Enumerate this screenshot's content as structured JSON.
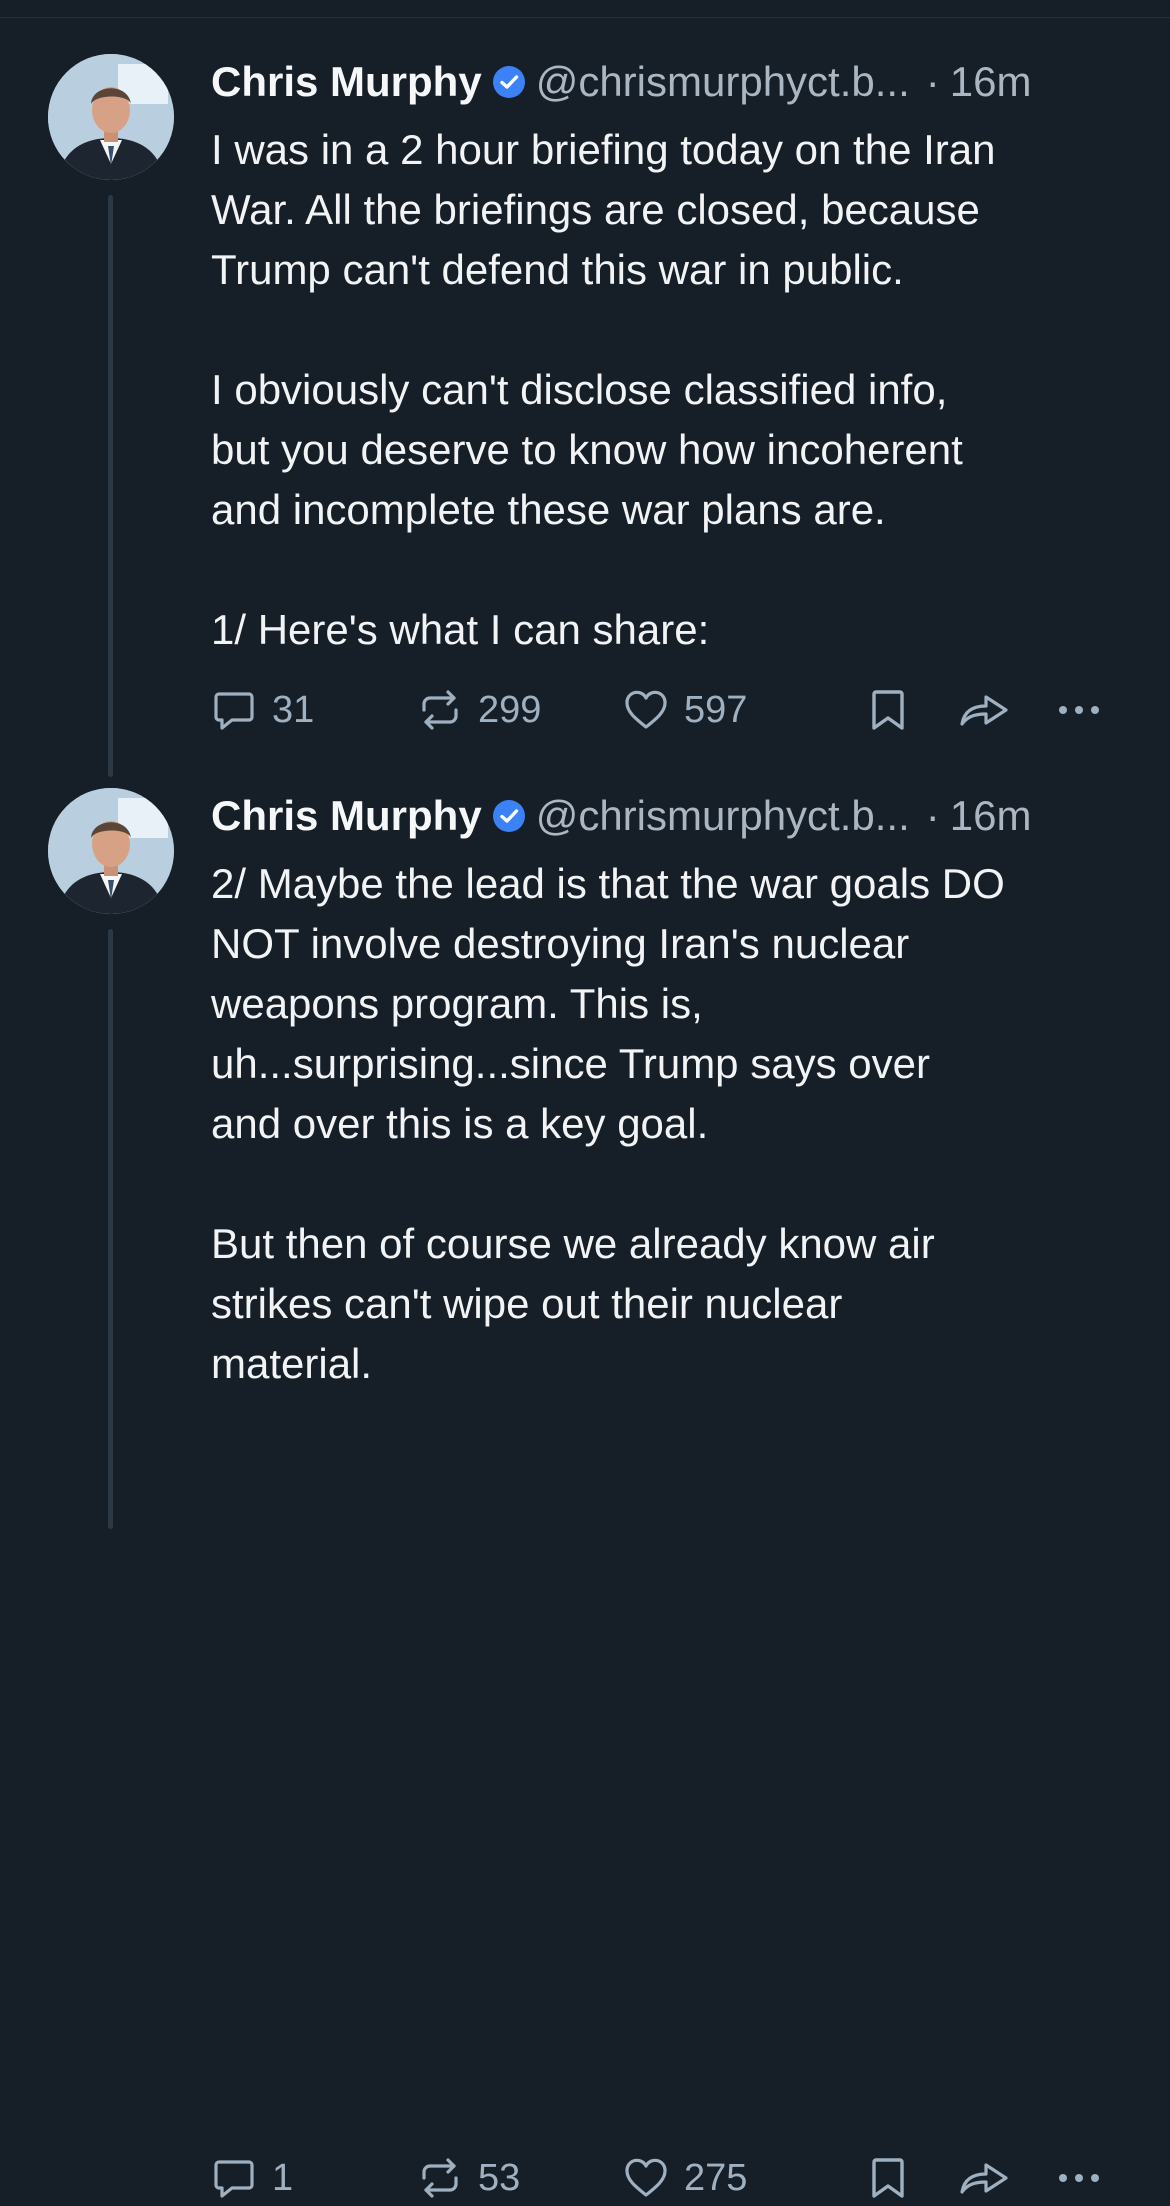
{
  "posts": [
    {
      "author_name": "Chris Murphy",
      "handle": "@chrismurphyct.b...",
      "separator": "·",
      "time": "16m",
      "text": "I was in a 2 hour briefing today on the Iran\nWar. All the briefings are closed, because\nTrump can't defend this war in public.\n\nI obviously can't disclose classified info,\nbut you deserve to know how incoherent\nand incomplete these war plans are.\n\n1/ Here's what I can share:",
      "replies": "31",
      "reposts": "299",
      "likes": "597"
    },
    {
      "author_name": "Chris Murphy",
      "handle": "@chrismurphyct.b...",
      "separator": "·",
      "time": "16m",
      "text": "2/ Maybe the lead is that the war goals DO\nNOT involve destroying Iran's nuclear\nweapons program. This is,\nuh...surprising...since Trump says over\nand over this is a key goal.\n\nBut then of course we already know air\nstrikes can't wipe out their nuclear\nmaterial.",
      "replies": "1",
      "reposts": "53",
      "likes": "275"
    }
  ],
  "colors": {
    "background": "#161e27",
    "text": "#f1f3f5",
    "muted": "#aab6c2",
    "verified": "#3b82f6",
    "thread_line": "#2b3846"
  },
  "icons": {
    "verified": "verified-badge-icon",
    "reply": "reply-icon",
    "repost": "repost-icon",
    "like": "heart-icon",
    "bookmark": "bookmark-icon",
    "share": "share-icon",
    "more": "more-icon"
  }
}
